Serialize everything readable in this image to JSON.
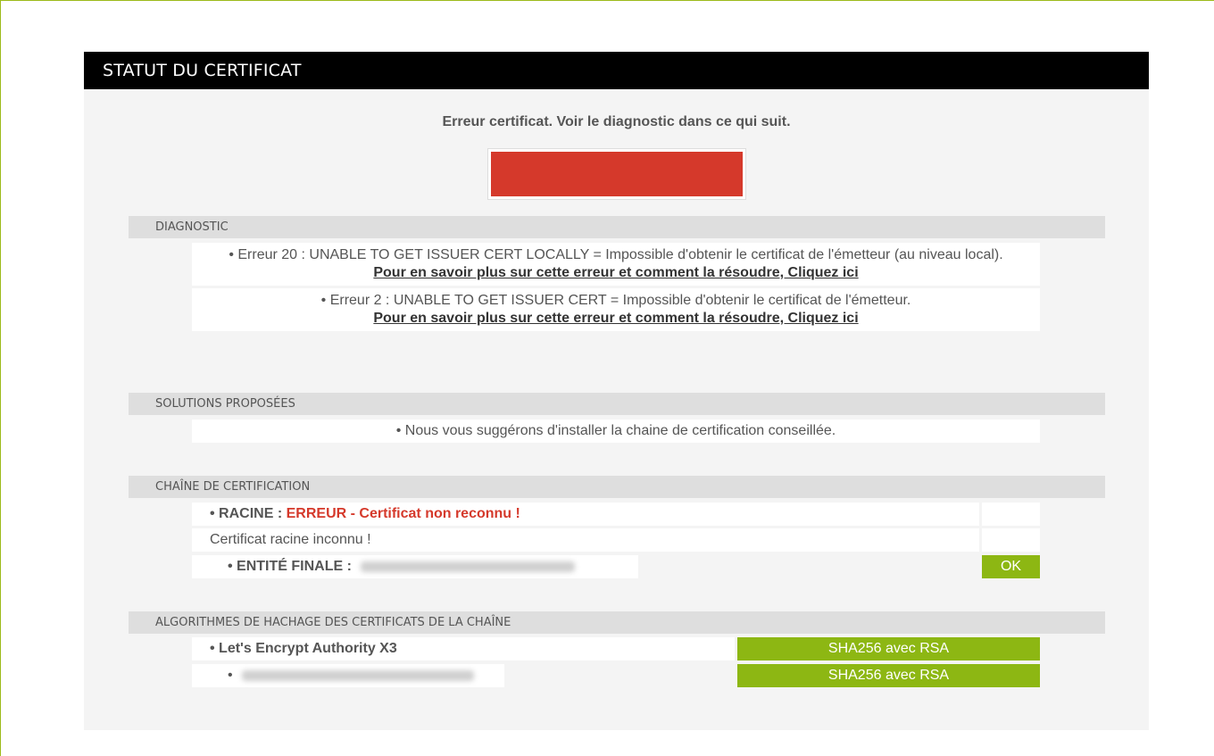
{
  "panel": {
    "title": "STATUT DU CERTIFICAT",
    "status_message": "Erreur certificat. Voir le diagnostic dans ce qui suit.",
    "status_color": "#d5392b"
  },
  "diagnostic": {
    "heading": "DIAGNOSTIC",
    "items": [
      {
        "text": "• Erreur 20 : UNABLE TO GET ISSUER CERT LOCALLY = Impossible d'obtenir le certificat de l'émetteur (au niveau local).",
        "link": "Pour en savoir plus sur cette erreur et comment la résoudre, Cliquez ici"
      },
      {
        "text": "• Erreur 2 : UNABLE TO GET ISSUER CERT = Impossible d'obtenir le certificat de l'émetteur.",
        "link": "Pour en savoir plus sur cette erreur et comment la résoudre, Cliquez ici"
      }
    ]
  },
  "solutions": {
    "heading": "SOLUTIONS PROPOSÉES",
    "text": "• Nous vous suggérons d'installer la chaine de certification conseillée."
  },
  "chain": {
    "heading": "CHAÎNE DE CERTIFICATION",
    "root_label": "• RACINE :",
    "root_error": "ERREUR - Certificat non reconnu !",
    "root_note": "Certificat racine inconnu !",
    "final_label": "• ENTITÉ FINALE :",
    "final_status": "OK"
  },
  "hash": {
    "heading": "ALGORITHMES DE HACHAGE DES CERTIFICATS DE LA CHAÎNE",
    "rows": [
      {
        "name": "• Let's Encrypt Authority X3",
        "algo": "SHA256 avec RSA"
      },
      {
        "name": "•",
        "algo": "SHA256 avec RSA"
      }
    ]
  },
  "colors": {
    "accent_green": "#8db713",
    "error_red": "#d5392b",
    "header_bg": "#000000"
  }
}
